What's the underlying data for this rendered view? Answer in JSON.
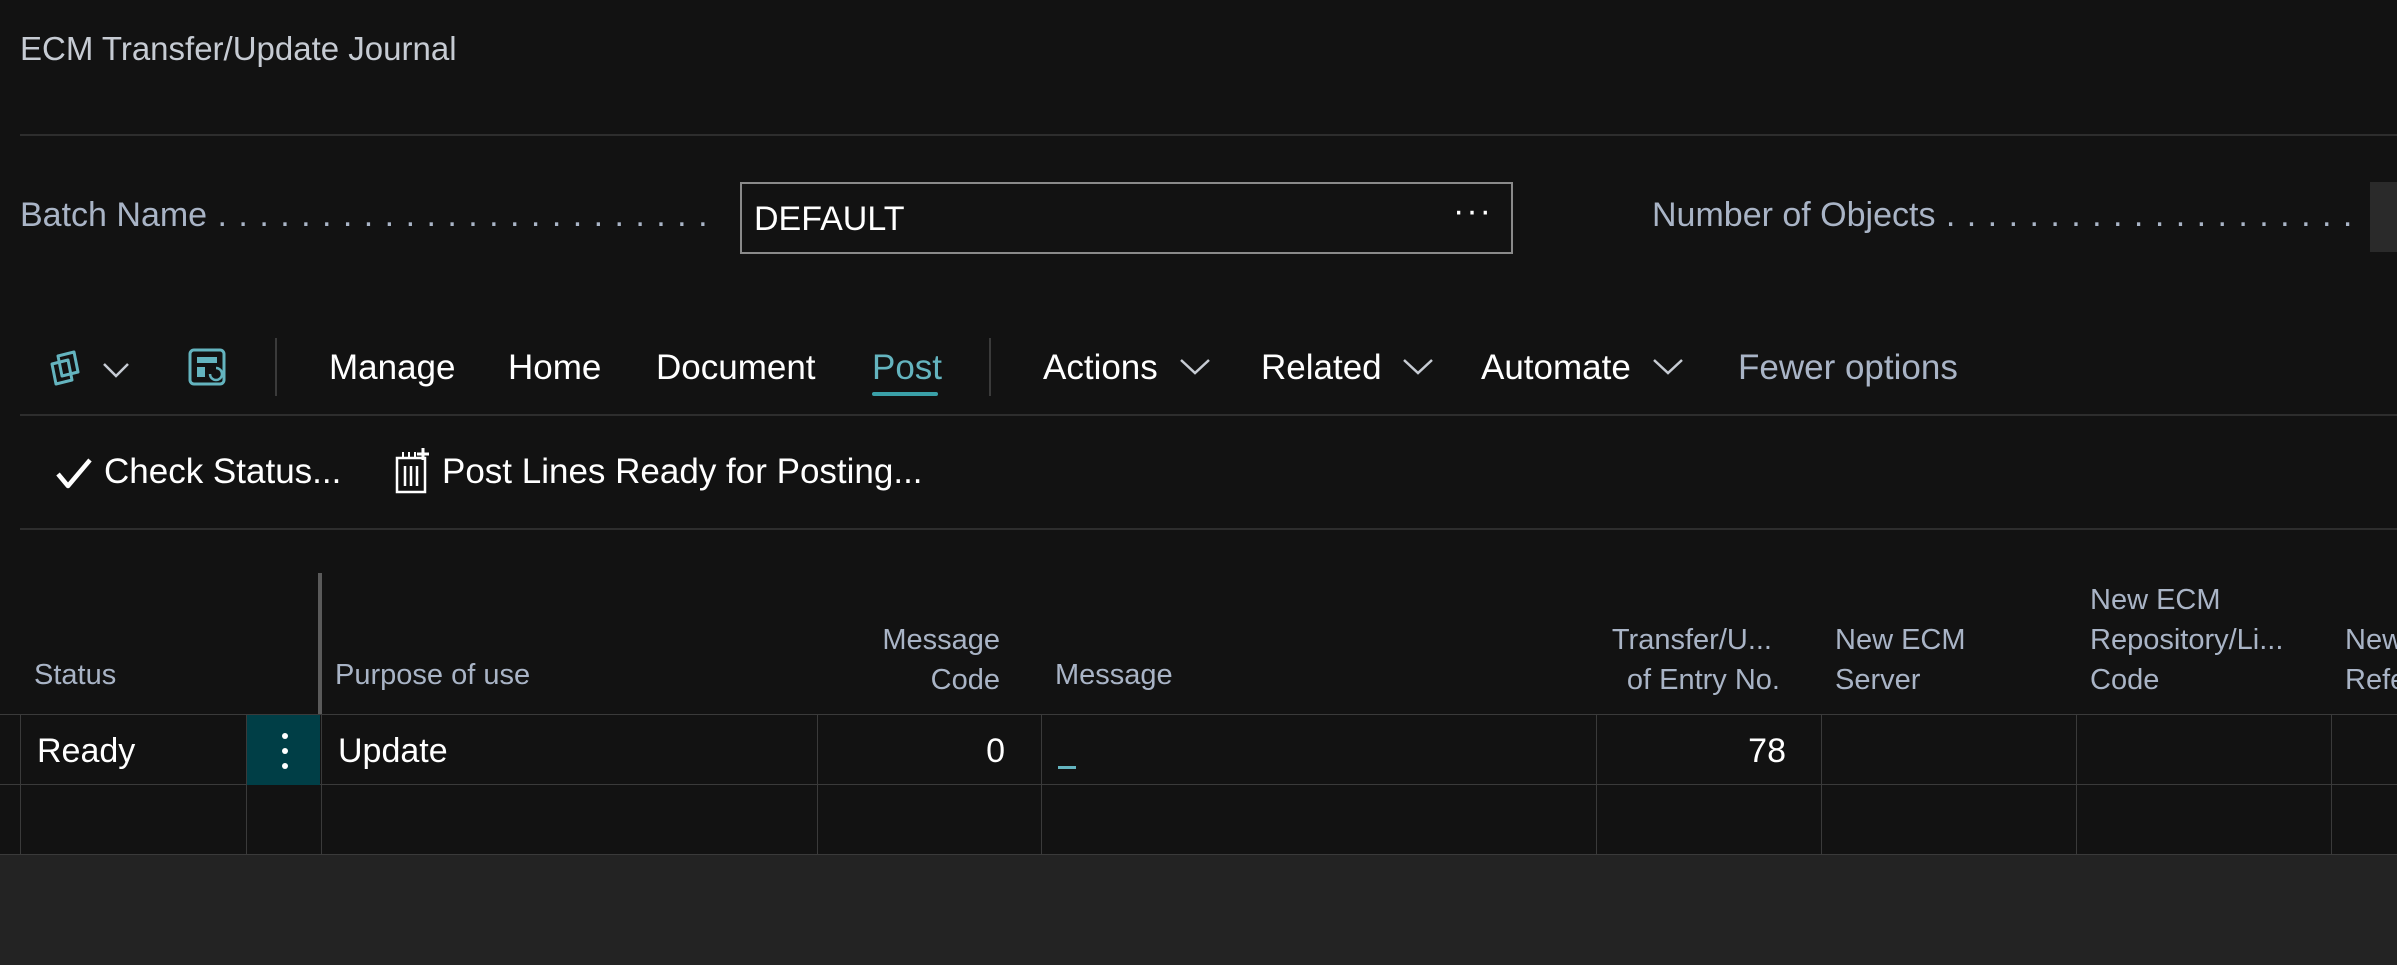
{
  "page": {
    "title": "ECM Transfer/Update Journal"
  },
  "fields": {
    "batch_name_label": "Batch Name",
    "batch_name_value": "DEFAULT",
    "batch_name_more": "···",
    "number_of_objects_label": "Number of Objects"
  },
  "actionbar": {
    "copilot_icon": "copilot-icon",
    "layout_icon": "personalize-layout-icon",
    "items": [
      {
        "label": "Manage"
      },
      {
        "label": "Home"
      },
      {
        "label": "Document"
      },
      {
        "label": "Post",
        "active": true
      },
      {
        "label": "Actions",
        "dropdown": true
      },
      {
        "label": "Related",
        "dropdown": true
      },
      {
        "label": "Automate",
        "dropdown": true
      },
      {
        "label": "Fewer options"
      }
    ],
    "accent_color": "#3aa0a8"
  },
  "subactions": [
    {
      "label": "Check Status...",
      "icon": "checkmark-icon"
    },
    {
      "label": "Post Lines Ready for Posting...",
      "icon": "post-batch-icon"
    }
  ],
  "table": {
    "headers": {
      "status": "Status",
      "purpose": "Purpose of use",
      "message_code_1": "Message",
      "message_code_2": "Code",
      "message": "Message",
      "transfer_1": "Transfer/U...",
      "transfer_2": "of Entry No.",
      "new_server_1": "New ECM",
      "new_server_2": "Server",
      "new_repo_1": "New ECM",
      "new_repo_2": "Repository/Li...",
      "new_repo_3": "Code",
      "new_ref_1": "New",
      "new_ref_2": "Refe"
    },
    "rows": [
      {
        "status": "Ready",
        "purpose": "Update",
        "message_code": "0",
        "message": "",
        "transfer_entry_no": "78",
        "new_ecm_server": "",
        "new_ecm_repository_code": "",
        "new_reference": ""
      }
    ]
  }
}
